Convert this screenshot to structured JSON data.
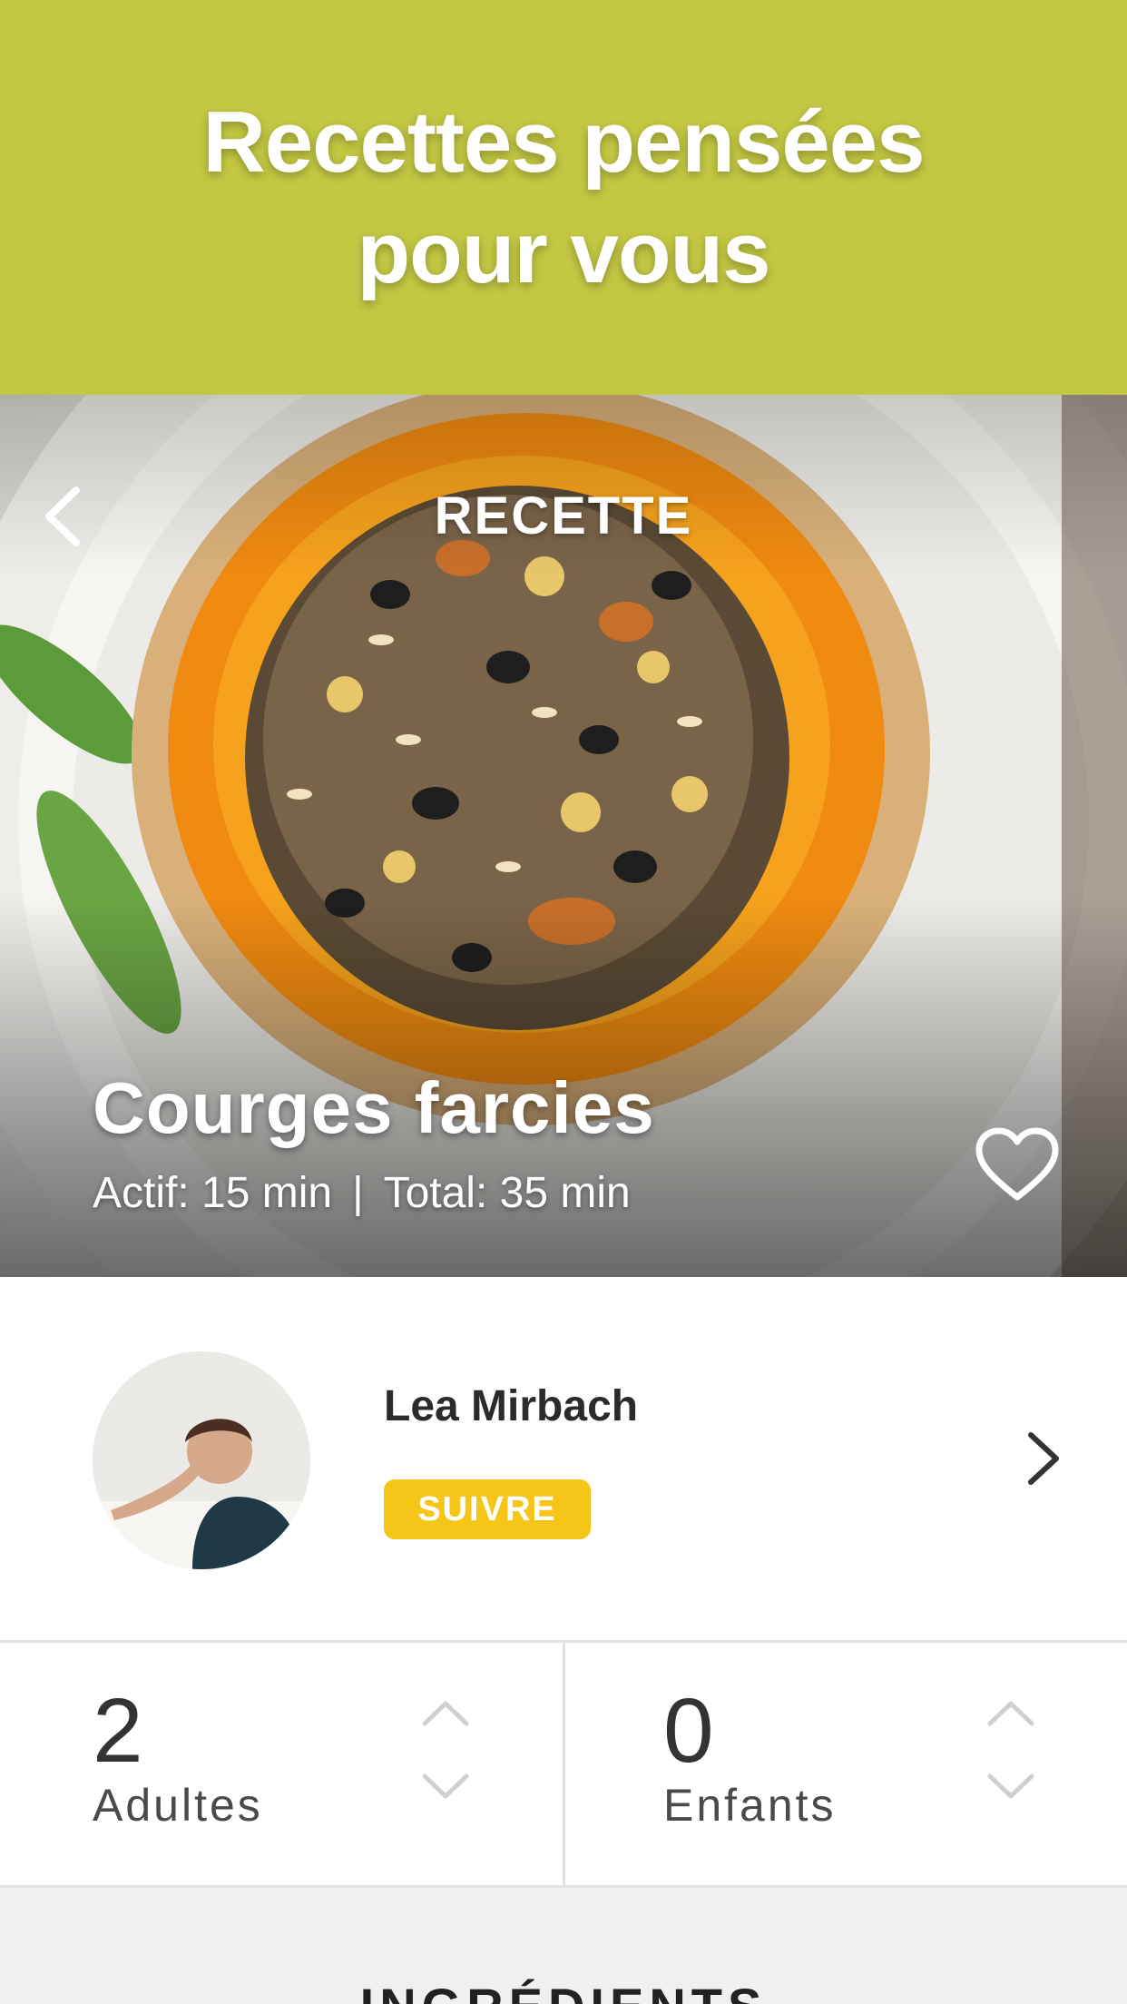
{
  "promo": {
    "title": "Recettes pensées pour vous"
  },
  "hero": {
    "section_label": "RECETTE",
    "title": "Courges farcies",
    "active_time": "Actif: 15 min",
    "separator": "|",
    "total_time": "Total: 35 min",
    "icons": {
      "back": "chevron-left-icon",
      "favorite": "heart-outline-icon"
    }
  },
  "author": {
    "name": "Lea Mirbach",
    "follow_label": "SUIVRE",
    "icons": {
      "more": "chevron-right-icon"
    }
  },
  "servings": {
    "adults": {
      "count": "2",
      "label": "Adultes"
    },
    "children": {
      "count": "0",
      "label": "Enfants"
    }
  },
  "ingredients": {
    "heading": "INGRÉDIENTS"
  },
  "colors": {
    "promo_bg": "#c3c843",
    "follow_btn": "#f5c518",
    "pumpkin": "#f08a10"
  }
}
